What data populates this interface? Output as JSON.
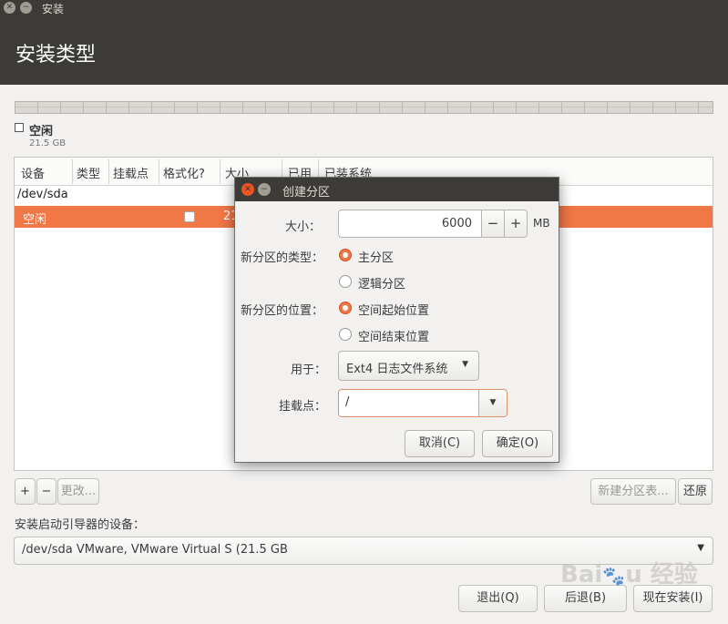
{
  "window": {
    "title": "安装"
  },
  "header": {
    "title": "安装类型"
  },
  "legend": {
    "label": "空闲",
    "size": "21.5 GB"
  },
  "table": {
    "columns": [
      "设备",
      "类型",
      "挂载点",
      "格式化?",
      "大小",
      "已用",
      "已装系统"
    ],
    "device": "/dev/sda",
    "selected_row": {
      "name": "空闲",
      "size": "21"
    }
  },
  "controls": {
    "add": "+",
    "remove": "−",
    "change": "更改...",
    "new_table": "新建分区表...",
    "revert": "还原"
  },
  "boot": {
    "label": "安装启动引导器的设备：",
    "value": "/dev/sda   VMware, VMware Virtual S (21.5 GB"
  },
  "footer": {
    "quit": "退出(Q)",
    "back": "后退(B)",
    "install": "现在安装(I)"
  },
  "dialog": {
    "title": "创建分区",
    "size_label": "大小：",
    "size_value": "6000",
    "minus": "−",
    "plus": "+",
    "unit": "MB",
    "type_label": "新分区的类型：",
    "type_primary": "主分区",
    "type_logical": "逻辑分区",
    "location_label": "新分区的位置：",
    "location_start": "空间起始位置",
    "location_end": "空间结束位置",
    "use_label": "用于：",
    "use_value": "Ext4 日志文件系统",
    "mount_label": "挂载点：",
    "mount_value": "/",
    "cancel": "取消(C)",
    "ok": "确定(O)"
  },
  "watermark": {
    "text": "Baidu 经验"
  },
  "colors": {
    "accent": "#f07746",
    "titlebar": "#3c3b37",
    "close": "#e95420"
  }
}
